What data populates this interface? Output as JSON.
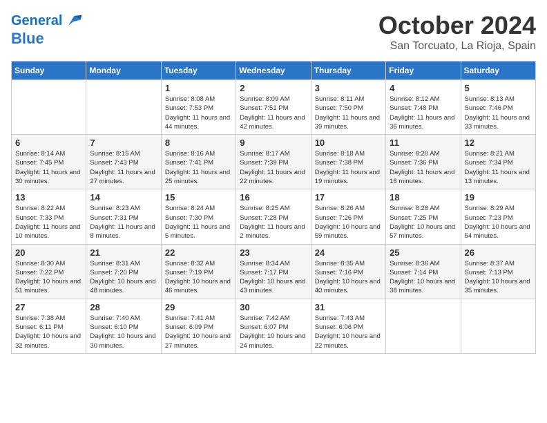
{
  "header": {
    "logo_line1": "General",
    "logo_line2": "Blue",
    "month": "October 2024",
    "location": "San Torcuato, La Rioja, Spain"
  },
  "days_of_week": [
    "Sunday",
    "Monday",
    "Tuesday",
    "Wednesday",
    "Thursday",
    "Friday",
    "Saturday"
  ],
  "weeks": [
    [
      {
        "day": "",
        "info": ""
      },
      {
        "day": "",
        "info": ""
      },
      {
        "day": "1",
        "info": "Sunrise: 8:08 AM\nSunset: 7:53 PM\nDaylight: 11 hours and 44 minutes."
      },
      {
        "day": "2",
        "info": "Sunrise: 8:09 AM\nSunset: 7:51 PM\nDaylight: 11 hours and 42 minutes."
      },
      {
        "day": "3",
        "info": "Sunrise: 8:11 AM\nSunset: 7:50 PM\nDaylight: 11 hours and 39 minutes."
      },
      {
        "day": "4",
        "info": "Sunrise: 8:12 AM\nSunset: 7:48 PM\nDaylight: 11 hours and 36 minutes."
      },
      {
        "day": "5",
        "info": "Sunrise: 8:13 AM\nSunset: 7:46 PM\nDaylight: 11 hours and 33 minutes."
      }
    ],
    [
      {
        "day": "6",
        "info": "Sunrise: 8:14 AM\nSunset: 7:45 PM\nDaylight: 11 hours and 30 minutes."
      },
      {
        "day": "7",
        "info": "Sunrise: 8:15 AM\nSunset: 7:43 PM\nDaylight: 11 hours and 27 minutes."
      },
      {
        "day": "8",
        "info": "Sunrise: 8:16 AM\nSunset: 7:41 PM\nDaylight: 11 hours and 25 minutes."
      },
      {
        "day": "9",
        "info": "Sunrise: 8:17 AM\nSunset: 7:39 PM\nDaylight: 11 hours and 22 minutes."
      },
      {
        "day": "10",
        "info": "Sunrise: 8:18 AM\nSunset: 7:38 PM\nDaylight: 11 hours and 19 minutes."
      },
      {
        "day": "11",
        "info": "Sunrise: 8:20 AM\nSunset: 7:36 PM\nDaylight: 11 hours and 16 minutes."
      },
      {
        "day": "12",
        "info": "Sunrise: 8:21 AM\nSunset: 7:34 PM\nDaylight: 11 hours and 13 minutes."
      }
    ],
    [
      {
        "day": "13",
        "info": "Sunrise: 8:22 AM\nSunset: 7:33 PM\nDaylight: 11 hours and 10 minutes."
      },
      {
        "day": "14",
        "info": "Sunrise: 8:23 AM\nSunset: 7:31 PM\nDaylight: 11 hours and 8 minutes."
      },
      {
        "day": "15",
        "info": "Sunrise: 8:24 AM\nSunset: 7:30 PM\nDaylight: 11 hours and 5 minutes."
      },
      {
        "day": "16",
        "info": "Sunrise: 8:25 AM\nSunset: 7:28 PM\nDaylight: 11 hours and 2 minutes."
      },
      {
        "day": "17",
        "info": "Sunrise: 8:26 AM\nSunset: 7:26 PM\nDaylight: 10 hours and 59 minutes."
      },
      {
        "day": "18",
        "info": "Sunrise: 8:28 AM\nSunset: 7:25 PM\nDaylight: 10 hours and 57 minutes."
      },
      {
        "day": "19",
        "info": "Sunrise: 8:29 AM\nSunset: 7:23 PM\nDaylight: 10 hours and 54 minutes."
      }
    ],
    [
      {
        "day": "20",
        "info": "Sunrise: 8:30 AM\nSunset: 7:22 PM\nDaylight: 10 hours and 51 minutes."
      },
      {
        "day": "21",
        "info": "Sunrise: 8:31 AM\nSunset: 7:20 PM\nDaylight: 10 hours and 48 minutes."
      },
      {
        "day": "22",
        "info": "Sunrise: 8:32 AM\nSunset: 7:19 PM\nDaylight: 10 hours and 46 minutes."
      },
      {
        "day": "23",
        "info": "Sunrise: 8:34 AM\nSunset: 7:17 PM\nDaylight: 10 hours and 43 minutes."
      },
      {
        "day": "24",
        "info": "Sunrise: 8:35 AM\nSunset: 7:16 PM\nDaylight: 10 hours and 40 minutes."
      },
      {
        "day": "25",
        "info": "Sunrise: 8:36 AM\nSunset: 7:14 PM\nDaylight: 10 hours and 38 minutes."
      },
      {
        "day": "26",
        "info": "Sunrise: 8:37 AM\nSunset: 7:13 PM\nDaylight: 10 hours and 35 minutes."
      }
    ],
    [
      {
        "day": "27",
        "info": "Sunrise: 7:38 AM\nSunset: 6:11 PM\nDaylight: 10 hours and 32 minutes."
      },
      {
        "day": "28",
        "info": "Sunrise: 7:40 AM\nSunset: 6:10 PM\nDaylight: 10 hours and 30 minutes."
      },
      {
        "day": "29",
        "info": "Sunrise: 7:41 AM\nSunset: 6:09 PM\nDaylight: 10 hours and 27 minutes."
      },
      {
        "day": "30",
        "info": "Sunrise: 7:42 AM\nSunset: 6:07 PM\nDaylight: 10 hours and 24 minutes."
      },
      {
        "day": "31",
        "info": "Sunrise: 7:43 AM\nSunset: 6:06 PM\nDaylight: 10 hours and 22 minutes."
      },
      {
        "day": "",
        "info": ""
      },
      {
        "day": "",
        "info": ""
      }
    ]
  ]
}
